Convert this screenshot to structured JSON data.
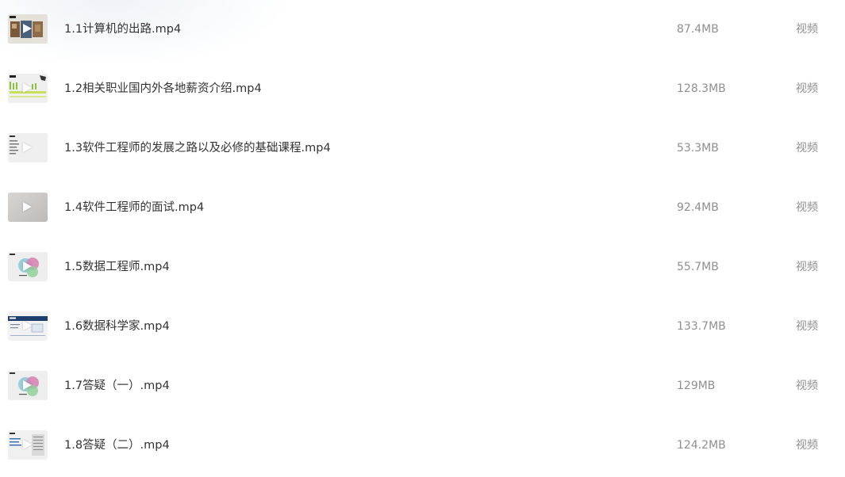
{
  "files": [
    {
      "name": "1.1计算机的出路.mp4",
      "size": "87.4MB",
      "type": "视频"
    },
    {
      "name": "1.2相关职业国内外各地薪资介绍.mp4",
      "size": "128.3MB",
      "type": "视频"
    },
    {
      "name": "1.3软件工程师的发展之路以及必修的基础课程.mp4",
      "size": "53.3MB",
      "type": "视频"
    },
    {
      "name": "1.4软件工程师的面试.mp4",
      "size": "92.4MB",
      "type": "视频"
    },
    {
      "name": "1.5数据工程师.mp4",
      "size": "55.7MB",
      "type": "视频"
    },
    {
      "name": "1.6数据科学家.mp4",
      "size": "133.7MB",
      "type": "视频"
    },
    {
      "name": "1.7答疑（一）.mp4",
      "size": "129MB",
      "type": "视频"
    },
    {
      "name": "1.8答疑（二）.mp4",
      "size": "124.2MB",
      "type": "视频"
    }
  ]
}
